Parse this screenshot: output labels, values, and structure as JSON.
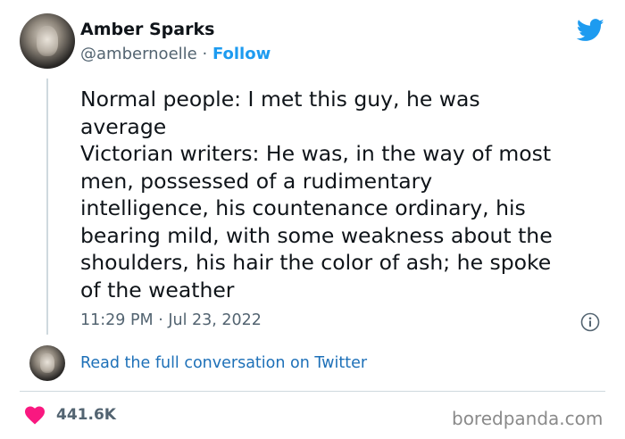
{
  "author": {
    "name": "Amber Sparks",
    "handle": "@ambernoelle",
    "separator": "·",
    "follow_label": "Follow"
  },
  "tweet": {
    "lines": [
      "Normal people: I met this guy, he was",
      "average",
      "Victorian writers: He was, in the way of most",
      "men, possessed of a rudimentary",
      "intelligence, his countenance ordinary, his",
      "bearing mild, with some weakness about the",
      "shoulders, his hair the color of ash; he spoke",
      "of the weather"
    ],
    "timestamp": "11:29 PM · Jul 23, 2022"
  },
  "conversation_link": "Read the full conversation on Twitter",
  "stats": {
    "likes": "441.6K"
  },
  "watermark": "boredpanda.com",
  "colors": {
    "accent": "#1d9bf0",
    "heart": "#f91880",
    "text": "#0f1419",
    "muted": "#536471"
  },
  "icons": [
    "twitter-bird-icon",
    "info-icon",
    "heart-icon"
  ]
}
